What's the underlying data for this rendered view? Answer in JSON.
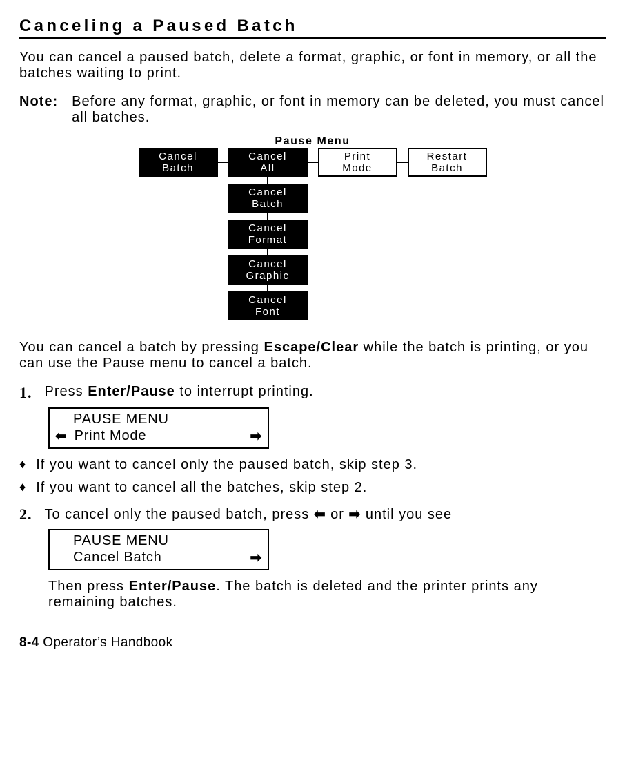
{
  "heading": "Canceling a Paused Batch",
  "intro": "You can cancel a paused batch, delete a format, graphic, or font in memory, or all the batches waiting to print.",
  "note_label": "Note:",
  "note_text": "Before any format, graphic, or font in memory can be deleted, you must cancel all batches.",
  "pause_menu_title": "Pause Menu",
  "menu": {
    "row": [
      {
        "label": "Cancel\nBatch",
        "style": "black"
      },
      {
        "label": "Cancel\nAll",
        "style": "black"
      },
      {
        "label": "Print\nMode",
        "style": "white"
      },
      {
        "label": "Restart\nBatch",
        "style": "white"
      }
    ],
    "sub": [
      "Cancel\nBatch",
      "Cancel\nFormat",
      "Cancel\nGraphic",
      "Cancel\nFont"
    ]
  },
  "mid": {
    "prefix": "You can cancel a batch by pressing ",
    "bold1": "Escape/Clear",
    "suffix": " while the batch is printing, or you can use the Pause menu to cancel a batch."
  },
  "step1": {
    "num": "1.",
    "prefix": "Press ",
    "bold": "Enter/Pause",
    "suffix": " to interrupt printing."
  },
  "display1": {
    "line1": "PAUSE MENU",
    "line2": "Print Mode",
    "left_arrow": "⬅",
    "right_arrow": "➡"
  },
  "bullet1": "If you want to cancel only the paused batch, skip step 3.",
  "bullet2": "If you want to cancel all the batches, skip step 2.",
  "step2": {
    "num": "2.",
    "prefix": "To cancel only the paused batch, press ",
    "arrow_left": "⬅",
    "or": " or ",
    "arrow_right": "➡",
    "suffix": " until you see"
  },
  "display2": {
    "line1": "PAUSE MENU",
    "line2": "Cancel Batch",
    "right_arrow": "➡"
  },
  "after2": {
    "prefix": "Then press ",
    "bold": "Enter/Pause",
    "suffix": ".  The batch is deleted and the printer prints any remaining batches."
  },
  "footer": {
    "page": "8-4",
    "title": "  Operator’s Handbook"
  },
  "bullet_char": "♦"
}
